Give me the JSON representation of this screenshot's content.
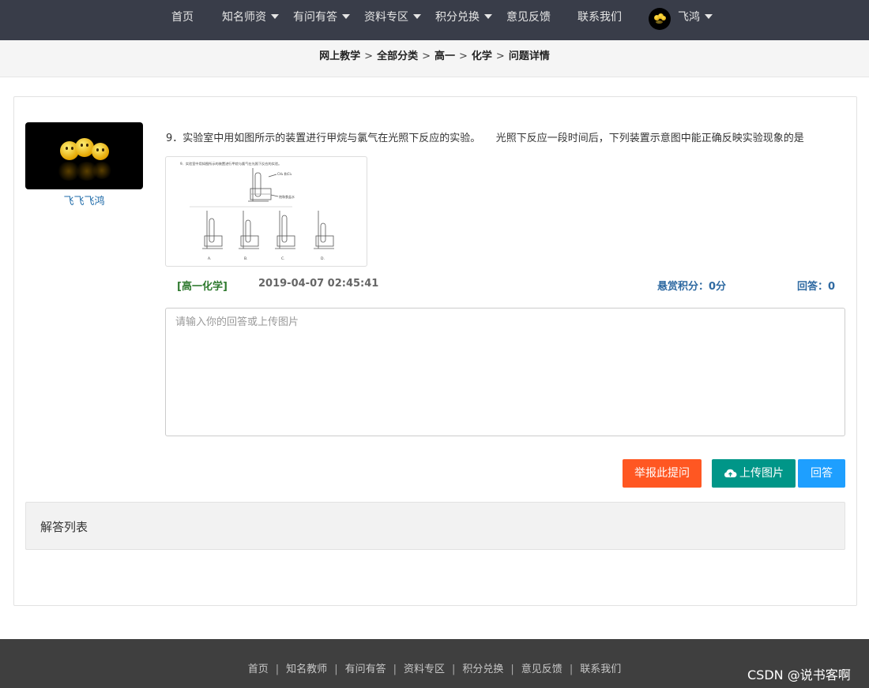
{
  "nav": {
    "items": [
      {
        "label": "首页",
        "dropdown": false
      },
      {
        "label": "知名师资",
        "dropdown": true
      },
      {
        "label": "有问有答",
        "dropdown": true
      },
      {
        "label": "资料专区",
        "dropdown": true
      },
      {
        "label": "积分兑换",
        "dropdown": true
      },
      {
        "label": "意见反馈",
        "dropdown": false
      },
      {
        "label": "联系我们",
        "dropdown": false
      }
    ],
    "user_name": "飞鸿"
  },
  "breadcrumb": [
    "网上教学",
    "全部分类",
    "高一",
    "化学",
    "问题详情"
  ],
  "breadcrumb_sep": ">",
  "asker": {
    "name": "飞飞飞鸿"
  },
  "question": {
    "text": "9．实验室中用如图所示的装置进行甲烷与氯气在光照下反应的实验。　　光照下反应一段时间后，下列装置示意图中能正确反映实验现象的是",
    "image_caption": "9．实验室中用如图所示的装置进行甲烷与氯气在光照下反应的实验。",
    "image_option_labels": [
      "A.",
      "B.",
      "C.",
      "D."
    ],
    "tag": "[高一化学]",
    "time": "2019-04-07 02:45:41",
    "reward": "悬赏积分：0分",
    "answers": "回答：0"
  },
  "answer_input": {
    "placeholder": "请输入你的回答或上传图片"
  },
  "buttons": {
    "report": "举报此提问",
    "upload": "上传图片",
    "answer": "回答"
  },
  "answers_panel": {
    "title": "解答列表"
  },
  "footer": {
    "links": [
      "首页",
      "知名教师",
      "有问有答",
      "资料专区",
      "积分兑换",
      "意见反馈",
      "联系我们"
    ],
    "sep": "|",
    "watermark": "CSDN @说书客啊"
  },
  "colors": {
    "nav_bg": "#393d49",
    "report": "#ff5722",
    "upload": "#009688",
    "answer": "#1e9fff",
    "tag_green": "#2f7a2f",
    "meta_blue": "#2f6aa2"
  }
}
